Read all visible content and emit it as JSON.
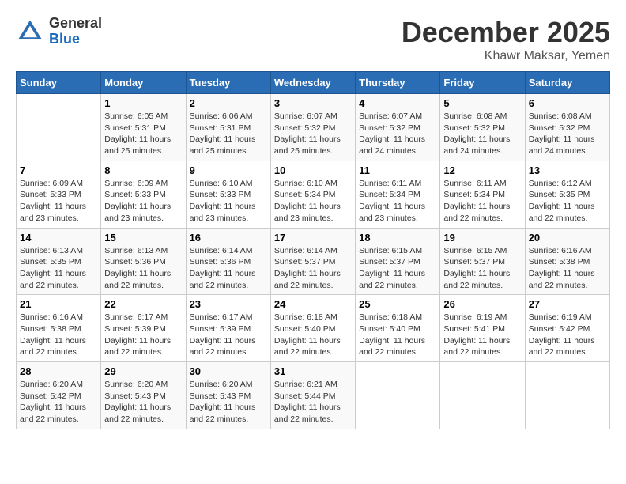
{
  "header": {
    "logo_general": "General",
    "logo_blue": "Blue",
    "month_title": "December 2025",
    "location": "Khawr Maksar, Yemen"
  },
  "days_of_week": [
    "Sunday",
    "Monday",
    "Tuesday",
    "Wednesday",
    "Thursday",
    "Friday",
    "Saturday"
  ],
  "weeks": [
    [
      {
        "day": "",
        "sunrise": "",
        "sunset": "",
        "daylight": ""
      },
      {
        "day": "1",
        "sunrise": "Sunrise: 6:05 AM",
        "sunset": "Sunset: 5:31 PM",
        "daylight": "Daylight: 11 hours and 25 minutes."
      },
      {
        "day": "2",
        "sunrise": "Sunrise: 6:06 AM",
        "sunset": "Sunset: 5:31 PM",
        "daylight": "Daylight: 11 hours and 25 minutes."
      },
      {
        "day": "3",
        "sunrise": "Sunrise: 6:07 AM",
        "sunset": "Sunset: 5:32 PM",
        "daylight": "Daylight: 11 hours and 25 minutes."
      },
      {
        "day": "4",
        "sunrise": "Sunrise: 6:07 AM",
        "sunset": "Sunset: 5:32 PM",
        "daylight": "Daylight: 11 hours and 24 minutes."
      },
      {
        "day": "5",
        "sunrise": "Sunrise: 6:08 AM",
        "sunset": "Sunset: 5:32 PM",
        "daylight": "Daylight: 11 hours and 24 minutes."
      },
      {
        "day": "6",
        "sunrise": "Sunrise: 6:08 AM",
        "sunset": "Sunset: 5:32 PM",
        "daylight": "Daylight: 11 hours and 24 minutes."
      }
    ],
    [
      {
        "day": "7",
        "sunrise": "Sunrise: 6:09 AM",
        "sunset": "Sunset: 5:33 PM",
        "daylight": "Daylight: 11 hours and 23 minutes."
      },
      {
        "day": "8",
        "sunrise": "Sunrise: 6:09 AM",
        "sunset": "Sunset: 5:33 PM",
        "daylight": "Daylight: 11 hours and 23 minutes."
      },
      {
        "day": "9",
        "sunrise": "Sunrise: 6:10 AM",
        "sunset": "Sunset: 5:33 PM",
        "daylight": "Daylight: 11 hours and 23 minutes."
      },
      {
        "day": "10",
        "sunrise": "Sunrise: 6:10 AM",
        "sunset": "Sunset: 5:34 PM",
        "daylight": "Daylight: 11 hours and 23 minutes."
      },
      {
        "day": "11",
        "sunrise": "Sunrise: 6:11 AM",
        "sunset": "Sunset: 5:34 PM",
        "daylight": "Daylight: 11 hours and 23 minutes."
      },
      {
        "day": "12",
        "sunrise": "Sunrise: 6:11 AM",
        "sunset": "Sunset: 5:34 PM",
        "daylight": "Daylight: 11 hours and 22 minutes."
      },
      {
        "day": "13",
        "sunrise": "Sunrise: 6:12 AM",
        "sunset": "Sunset: 5:35 PM",
        "daylight": "Daylight: 11 hours and 22 minutes."
      }
    ],
    [
      {
        "day": "14",
        "sunrise": "Sunrise: 6:13 AM",
        "sunset": "Sunset: 5:35 PM",
        "daylight": "Daylight: 11 hours and 22 minutes."
      },
      {
        "day": "15",
        "sunrise": "Sunrise: 6:13 AM",
        "sunset": "Sunset: 5:36 PM",
        "daylight": "Daylight: 11 hours and 22 minutes."
      },
      {
        "day": "16",
        "sunrise": "Sunrise: 6:14 AM",
        "sunset": "Sunset: 5:36 PM",
        "daylight": "Daylight: 11 hours and 22 minutes."
      },
      {
        "day": "17",
        "sunrise": "Sunrise: 6:14 AM",
        "sunset": "Sunset: 5:37 PM",
        "daylight": "Daylight: 11 hours and 22 minutes."
      },
      {
        "day": "18",
        "sunrise": "Sunrise: 6:15 AM",
        "sunset": "Sunset: 5:37 PM",
        "daylight": "Daylight: 11 hours and 22 minutes."
      },
      {
        "day": "19",
        "sunrise": "Sunrise: 6:15 AM",
        "sunset": "Sunset: 5:37 PM",
        "daylight": "Daylight: 11 hours and 22 minutes."
      },
      {
        "day": "20",
        "sunrise": "Sunrise: 6:16 AM",
        "sunset": "Sunset: 5:38 PM",
        "daylight": "Daylight: 11 hours and 22 minutes."
      }
    ],
    [
      {
        "day": "21",
        "sunrise": "Sunrise: 6:16 AM",
        "sunset": "Sunset: 5:38 PM",
        "daylight": "Daylight: 11 hours and 22 minutes."
      },
      {
        "day": "22",
        "sunrise": "Sunrise: 6:17 AM",
        "sunset": "Sunset: 5:39 PM",
        "daylight": "Daylight: 11 hours and 22 minutes."
      },
      {
        "day": "23",
        "sunrise": "Sunrise: 6:17 AM",
        "sunset": "Sunset: 5:39 PM",
        "daylight": "Daylight: 11 hours and 22 minutes."
      },
      {
        "day": "24",
        "sunrise": "Sunrise: 6:18 AM",
        "sunset": "Sunset: 5:40 PM",
        "daylight": "Daylight: 11 hours and 22 minutes."
      },
      {
        "day": "25",
        "sunrise": "Sunrise: 6:18 AM",
        "sunset": "Sunset: 5:40 PM",
        "daylight": "Daylight: 11 hours and 22 minutes."
      },
      {
        "day": "26",
        "sunrise": "Sunrise: 6:19 AM",
        "sunset": "Sunset: 5:41 PM",
        "daylight": "Daylight: 11 hours and 22 minutes."
      },
      {
        "day": "27",
        "sunrise": "Sunrise: 6:19 AM",
        "sunset": "Sunset: 5:42 PM",
        "daylight": "Daylight: 11 hours and 22 minutes."
      }
    ],
    [
      {
        "day": "28",
        "sunrise": "Sunrise: 6:20 AM",
        "sunset": "Sunset: 5:42 PM",
        "daylight": "Daylight: 11 hours and 22 minutes."
      },
      {
        "day": "29",
        "sunrise": "Sunrise: 6:20 AM",
        "sunset": "Sunset: 5:43 PM",
        "daylight": "Daylight: 11 hours and 22 minutes."
      },
      {
        "day": "30",
        "sunrise": "Sunrise: 6:20 AM",
        "sunset": "Sunset: 5:43 PM",
        "daylight": "Daylight: 11 hours and 22 minutes."
      },
      {
        "day": "31",
        "sunrise": "Sunrise: 6:21 AM",
        "sunset": "Sunset: 5:44 PM",
        "daylight": "Daylight: 11 hours and 22 minutes."
      },
      {
        "day": "",
        "sunrise": "",
        "sunset": "",
        "daylight": ""
      },
      {
        "day": "",
        "sunrise": "",
        "sunset": "",
        "daylight": ""
      },
      {
        "day": "",
        "sunrise": "",
        "sunset": "",
        "daylight": ""
      }
    ]
  ]
}
